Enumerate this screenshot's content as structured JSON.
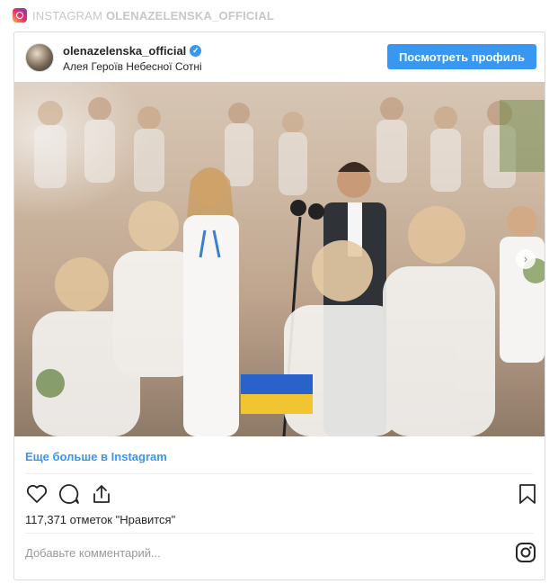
{
  "embed_header": {
    "prefix": "INSTAGRAM",
    "account": "OLENAZELENSKA_OFFICIAL"
  },
  "post": {
    "username": "olenazelenska_official",
    "verified": true,
    "location": "Алея Героїв Небесної Сотні",
    "profile_button": "Посмотреть профиль",
    "more_link": "Еще больше в Instagram",
    "likes": "117,371 отметок \"Нравится\"",
    "comment_placeholder": "Добавьте комментарий...",
    "photo_alt": "photo-of-people-in-white-clothes-with-ribbons"
  },
  "icons": {
    "like": "heart-icon",
    "comment": "comment-icon",
    "share": "share-icon",
    "save": "bookmark-icon",
    "instagram": "instagram-icon",
    "next": "chevron-right-icon"
  },
  "colors": {
    "accent": "#3897f0",
    "text": "#262626",
    "muted": "#999999",
    "border": "#dbdbdb"
  }
}
